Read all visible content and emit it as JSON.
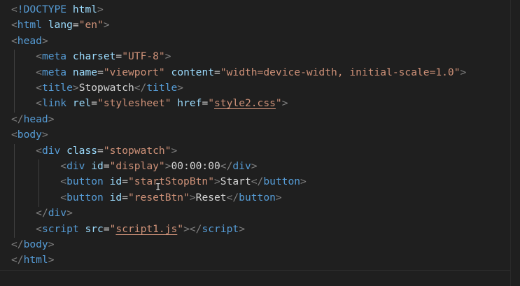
{
  "editor": {
    "language": "html",
    "lines": [
      {
        "indent": "",
        "parts": [
          [
            "br",
            "<"
          ],
          [
            "tag",
            "!DOCTYPE"
          ],
          [
            "txt",
            " "
          ],
          [
            "attr",
            "html"
          ],
          [
            "br",
            ">"
          ]
        ]
      },
      {
        "indent": "",
        "parts": [
          [
            "br",
            "<"
          ],
          [
            "tag",
            "html"
          ],
          [
            "txt",
            " "
          ],
          [
            "attr",
            "lang"
          ],
          [
            "eq",
            "="
          ],
          [
            "str",
            "\"en\""
          ],
          [
            "br",
            ">"
          ]
        ]
      },
      {
        "indent": "",
        "parts": [
          [
            "br",
            "<"
          ],
          [
            "tag",
            "head"
          ],
          [
            "br",
            ">"
          ]
        ]
      },
      {
        "indent": "    ",
        "parts": [
          [
            "br",
            "<"
          ],
          [
            "tag",
            "meta"
          ],
          [
            "txt",
            " "
          ],
          [
            "attr",
            "charset"
          ],
          [
            "eq",
            "="
          ],
          [
            "str",
            "\"UTF-8\""
          ],
          [
            "br",
            ">"
          ]
        ]
      },
      {
        "indent": "    ",
        "parts": [
          [
            "br",
            "<"
          ],
          [
            "tag",
            "meta"
          ],
          [
            "txt",
            " "
          ],
          [
            "attr",
            "name"
          ],
          [
            "eq",
            "="
          ],
          [
            "str",
            "\"viewport\""
          ],
          [
            "txt",
            " "
          ],
          [
            "attr",
            "content"
          ],
          [
            "eq",
            "="
          ],
          [
            "str",
            "\"width=device-width, initial-scale=1.0\""
          ],
          [
            "br",
            ">"
          ]
        ]
      },
      {
        "indent": "    ",
        "parts": [
          [
            "br",
            "<"
          ],
          [
            "tag",
            "title"
          ],
          [
            "br",
            ">"
          ],
          [
            "txt",
            "Stopwatch"
          ],
          [
            "br",
            "</"
          ],
          [
            "tag",
            "title"
          ],
          [
            "br",
            ">"
          ]
        ]
      },
      {
        "indent": "    ",
        "parts": [
          [
            "br",
            "<"
          ],
          [
            "tag",
            "link"
          ],
          [
            "txt",
            " "
          ],
          [
            "attr",
            "rel"
          ],
          [
            "eq",
            "="
          ],
          [
            "str",
            "\"stylesheet\""
          ],
          [
            "txt",
            " "
          ],
          [
            "attr",
            "href"
          ],
          [
            "eq",
            "="
          ],
          [
            "str",
            "\""
          ],
          [
            "strlink",
            "style2.css"
          ],
          [
            "str",
            "\""
          ],
          [
            "br",
            ">"
          ]
        ]
      },
      {
        "indent": "",
        "parts": [
          [
            "br",
            "</"
          ],
          [
            "tag",
            "head"
          ],
          [
            "br",
            ">"
          ]
        ]
      },
      {
        "indent": "",
        "parts": [
          [
            "br",
            "<"
          ],
          [
            "tag",
            "body"
          ],
          [
            "br",
            ">"
          ]
        ]
      },
      {
        "indent": "    ",
        "parts": [
          [
            "br",
            "<"
          ],
          [
            "tag",
            "div"
          ],
          [
            "txt",
            " "
          ],
          [
            "attr",
            "class"
          ],
          [
            "eq",
            "="
          ],
          [
            "str",
            "\"stopwatch\""
          ],
          [
            "br",
            ">"
          ]
        ]
      },
      {
        "indent": "        ",
        "parts": [
          [
            "br",
            "<"
          ],
          [
            "tag",
            "div"
          ],
          [
            "txt",
            " "
          ],
          [
            "attr",
            "id"
          ],
          [
            "eq",
            "="
          ],
          [
            "str",
            "\"display\""
          ],
          [
            "br",
            ">"
          ],
          [
            "txt",
            "00:00:00"
          ],
          [
            "br",
            "</"
          ],
          [
            "tag",
            "div"
          ],
          [
            "br",
            ">"
          ]
        ]
      },
      {
        "indent": "        ",
        "parts": [
          [
            "br",
            "<"
          ],
          [
            "tag",
            "button"
          ],
          [
            "txt",
            " "
          ],
          [
            "attr",
            "id"
          ],
          [
            "eq",
            "="
          ],
          [
            "str",
            "\"startStopBtn\""
          ],
          [
            "br",
            ">"
          ],
          [
            "txt",
            "Start"
          ],
          [
            "br",
            "</"
          ],
          [
            "tag",
            "button"
          ],
          [
            "br",
            ">"
          ]
        ]
      },
      {
        "indent": "        ",
        "parts": [
          [
            "br",
            "<"
          ],
          [
            "tag",
            "button"
          ],
          [
            "txt",
            " "
          ],
          [
            "attr",
            "id"
          ],
          [
            "eq",
            "="
          ],
          [
            "str",
            "\"resetBtn\""
          ],
          [
            "br",
            ">"
          ],
          [
            "txt",
            "Reset"
          ],
          [
            "br",
            "</"
          ],
          [
            "tag",
            "button"
          ],
          [
            "br",
            ">"
          ]
        ]
      },
      {
        "indent": "    ",
        "parts": [
          [
            "br",
            "</"
          ],
          [
            "tag",
            "div"
          ],
          [
            "br",
            ">"
          ]
        ]
      },
      {
        "indent": "    ",
        "parts": [
          [
            "br",
            "<"
          ],
          [
            "tag",
            "script"
          ],
          [
            "txt",
            " "
          ],
          [
            "attr",
            "src"
          ],
          [
            "eq",
            "="
          ],
          [
            "str",
            "\""
          ],
          [
            "strlink",
            "script1.js"
          ],
          [
            "str",
            "\""
          ],
          [
            "br",
            ">"
          ],
          [
            "br",
            "</"
          ],
          [
            "tag",
            "script"
          ],
          [
            "br",
            ">"
          ]
        ]
      },
      {
        "indent": "",
        "parts": [
          [
            "br",
            "</"
          ],
          [
            "tag",
            "body"
          ],
          [
            "br",
            ">"
          ]
        ]
      },
      {
        "indent": "",
        "parts": [
          [
            "br",
            "</"
          ],
          [
            "tag",
            "html"
          ],
          [
            "br",
            ">"
          ]
        ]
      }
    ]
  },
  "colors": {
    "background": "#1f1f1f",
    "tag": "#569cd6",
    "bracket": "#808080",
    "attribute": "#9cdcfe",
    "string": "#ce9178",
    "text": "#d4d4d4"
  },
  "icons": {
    "text_cursor": "i-beam-cursor-icon"
  }
}
